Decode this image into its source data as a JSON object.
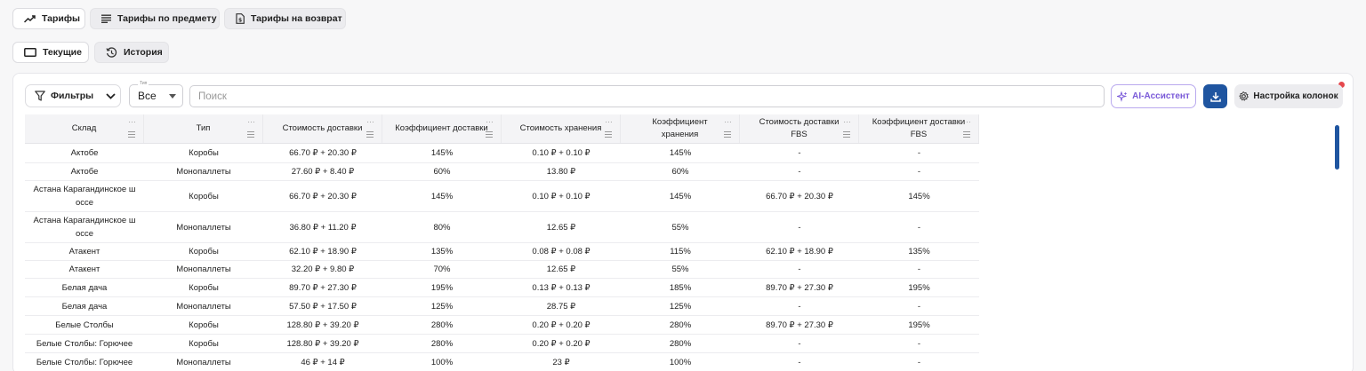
{
  "tabs": [
    {
      "label": "Тарифы",
      "icon": "trend-up-icon",
      "active": true
    },
    {
      "label": "Тарифы по предмету",
      "icon": "list-lines-icon",
      "active": false
    },
    {
      "label": "Тарифы на возврат",
      "icon": "file-money-icon",
      "active": false
    }
  ],
  "subtabs": [
    {
      "label": "Текущие",
      "icon": "rectangle-icon",
      "active": true
    },
    {
      "label": "История",
      "icon": "history-icon",
      "active": false
    }
  ],
  "toolbar": {
    "filters_label": "Фильтры",
    "type_select_label": "Тип",
    "type_select_value": "Все",
    "search_placeholder": "Поиск",
    "ai_label": "AI-Ассистент",
    "columns_label": "Настройка колонок"
  },
  "table": {
    "columns": [
      "Склад",
      "Тип",
      "Стоимость доставки",
      "Коэффициент доставки",
      "Стоимость хранения",
      "Коэффициент хранения",
      "Стоимость доставки FBS",
      "Коэффициент доставки FBS"
    ],
    "rows": [
      [
        "Актобе",
        "Коробы",
        "66.70 ₽ + 20.30 ₽",
        "145%",
        "0.10 ₽ + 0.10 ₽",
        "145%",
        "-",
        "-"
      ],
      [
        "Актобе",
        "Монопаллеты",
        "27.60 ₽ + 8.40 ₽",
        "60%",
        "13.80 ₽",
        "60%",
        "-",
        "-"
      ],
      [
        "Астана Карагандинское ш оссе",
        "Коробы",
        "66.70 ₽ + 20.30 ₽",
        "145%",
        "0.10 ₽ + 0.10 ₽",
        "145%",
        "66.70 ₽ + 20.30 ₽",
        "145%"
      ],
      [
        "Астана Карагандинское ш оссе",
        "Монопаллеты",
        "36.80 ₽ + 11.20 ₽",
        "80%",
        "12.65 ₽",
        "55%",
        "-",
        "-"
      ],
      [
        "Атакент",
        "Коробы",
        "62.10 ₽ + 18.90 ₽",
        "135%",
        "0.08 ₽ + 0.08 ₽",
        "115%",
        "62.10 ₽ + 18.90 ₽",
        "135%"
      ],
      [
        "Атакент",
        "Монопаллеты",
        "32.20 ₽ + 9.80 ₽",
        "70%",
        "12.65 ₽",
        "55%",
        "-",
        "-"
      ],
      [
        "Белая дача",
        "Коробы",
        "89.70 ₽ + 27.30 ₽",
        "195%",
        "0.13 ₽ + 0.13 ₽",
        "185%",
        "89.70 ₽ + 27.30 ₽",
        "195%"
      ],
      [
        "Белая дача",
        "Монопаллеты",
        "57.50 ₽ + 17.50 ₽",
        "125%",
        "28.75 ₽",
        "125%",
        "-",
        "-"
      ],
      [
        "Белые Столбы",
        "Коробы",
        "128.80 ₽ + 39.20 ₽",
        "280%",
        "0.20 ₽ + 0.20 ₽",
        "280%",
        "89.70 ₽ + 27.30 ₽",
        "195%"
      ],
      [
        "Белые Столбы: Горючее",
        "Коробы",
        "128.80 ₽ + 39.20 ₽",
        "280%",
        "0.20 ₽ + 0.20 ₽",
        "280%",
        "-",
        "-"
      ],
      [
        "Белые Столбы: Горючее",
        "Монопаллеты",
        "46 ₽ + 14 ₽",
        "100%",
        "23 ₽",
        "100%",
        "-",
        "-"
      ]
    ]
  },
  "colors": {
    "accent": "#1f55a0",
    "ai_accent": "#7a5ad8",
    "notification": "#e5484d"
  }
}
